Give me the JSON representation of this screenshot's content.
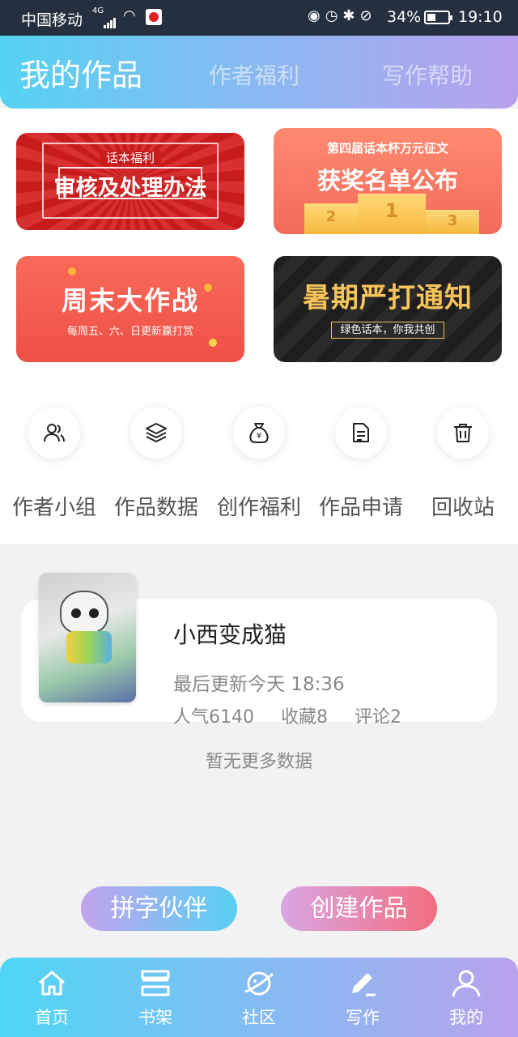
{
  "status_bar": {
    "carrier": "中国移动",
    "network": "4G",
    "battery": "34%",
    "time": "19:10"
  },
  "header": {
    "tabs": [
      {
        "label": "我的作品",
        "active": true
      },
      {
        "label": "作者福利",
        "active": false
      },
      {
        "label": "写作帮助",
        "active": false
      }
    ]
  },
  "banners": {
    "review": {
      "sub": "话本福利",
      "main": "审核及处理办法"
    },
    "award": {
      "sub": "第四届话本杯万元征文",
      "main": "获奖名单公布",
      "podium": [
        "2",
        "1",
        "3"
      ]
    },
    "weekend": {
      "main": "周末大作战",
      "sub": "每周五、六、日更新赢打赏"
    },
    "summer": {
      "main": "暑期严打通知",
      "sub": "绿色话本，你我共创"
    }
  },
  "quick_actions": [
    {
      "label": "作者小组",
      "icon": "users-icon"
    },
    {
      "label": "作品数据",
      "icon": "layers-icon"
    },
    {
      "label": "创作福利",
      "icon": "money-bag-icon"
    },
    {
      "label": "作品申请",
      "icon": "document-icon"
    },
    {
      "label": "回收站",
      "icon": "trash-icon"
    }
  ],
  "work": {
    "title": "小西变成猫",
    "updated": "最后更新今天 18:36",
    "popularity": "人气6140",
    "favorites": "收藏8",
    "comments": "评论2"
  },
  "no_more": "暂无更多数据",
  "fab": {
    "partner": "拼字伙伴",
    "create": "创建作品"
  },
  "bottom_nav": [
    {
      "label": "首页",
      "icon": "home-icon"
    },
    {
      "label": "书架",
      "icon": "bookshelf-icon"
    },
    {
      "label": "社区",
      "icon": "planet-icon"
    },
    {
      "label": "写作",
      "icon": "pen-icon",
      "active": true
    },
    {
      "label": "我的",
      "icon": "profile-icon"
    }
  ],
  "colors": {
    "header_gradient": [
      "#55d2f2",
      "#b7a0ec"
    ],
    "status_bar": "#243040",
    "nav_gradient": [
      "#4fd6f6",
      "#b9a2ec"
    ]
  }
}
